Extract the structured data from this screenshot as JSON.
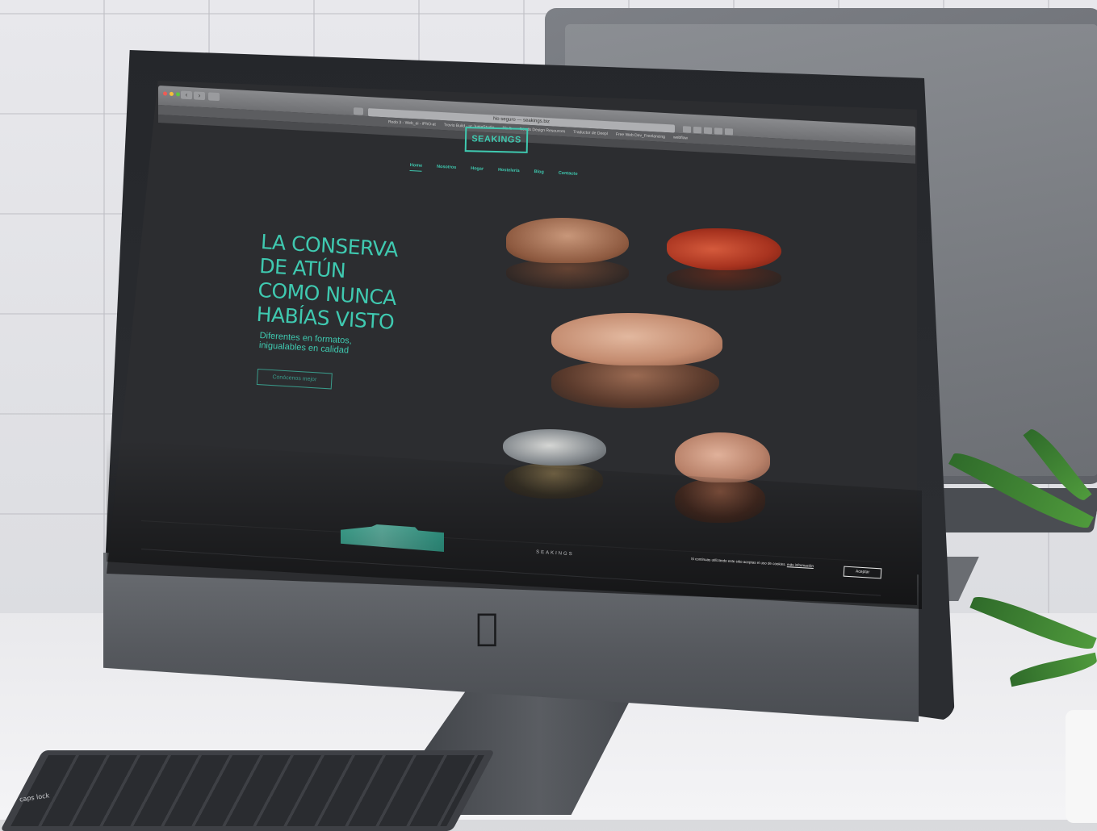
{
  "browser": {
    "address": "No seguro — seakings.biz",
    "bookmarks": [
      "Redo 3 - Web_ai - iPhO-at",
      "Trovio Build - ur JuniaStudio",
      "Pix It",
      "Needs Design Resources",
      "Traductor de Deepl",
      "Free Web Dev_Freelancing",
      "webflow"
    ]
  },
  "site": {
    "logo": "SEAKINGS",
    "menu": [
      "Home",
      "Nosotros",
      "Hogar",
      "Hostelería",
      "Blog",
      "Contacto"
    ],
    "hero_lines": [
      "LA CONSERVA",
      "DE ATÚN",
      "COMO NUNCA",
      "HABÍAS VISTO"
    ],
    "subtitle_lines": [
      "Diferentes en formatos,",
      "inigualables en calidad"
    ],
    "cta": "Conócenos mejor",
    "footer_brand": "SEAKINGS",
    "cookie_text": "Si continuas utilizando este sitio aceptas el uso de cookies.",
    "cookie_link": "más información",
    "accept_button": "Aceptar"
  },
  "keyboard_label": "caps lock",
  "colors": {
    "accent": "#3fc9b0",
    "screen_bg": "#2c2d30"
  }
}
